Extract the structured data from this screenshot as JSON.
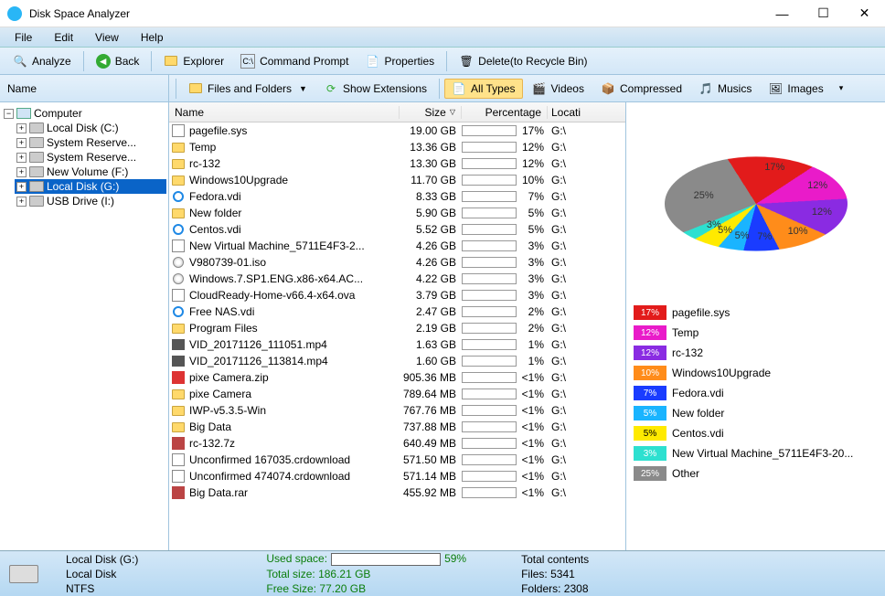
{
  "app": {
    "title": "Disk Space Analyzer"
  },
  "menu": {
    "file": "File",
    "edit": "Edit",
    "view": "View",
    "help": "Help"
  },
  "toolbar": {
    "analyze": "Analyze",
    "back": "Back",
    "explorer": "Explorer",
    "cmd": "Command Prompt",
    "props": "Properties",
    "delete": "Delete(to Recycle Bin)"
  },
  "row2": {
    "name_header": "Name",
    "files_folders": "Files and Folders",
    "show_ext": "Show Extensions",
    "all_types": "All Types",
    "videos": "Videos",
    "compressed": "Compressed",
    "musics": "Musics",
    "images": "Images"
  },
  "tree": {
    "root": "Computer",
    "items": [
      "Local Disk (C:)",
      "System Reserve...",
      "System Reserve...",
      "New Volume (F:)",
      "Local Disk (G:)",
      "USB Drive (I:)"
    ],
    "selected_index": 4
  },
  "cols": {
    "name": "Name",
    "size": "Size",
    "pct": "Percentage",
    "loc": "Locati"
  },
  "files": [
    {
      "icon": "sys",
      "name": "pagefile.sys",
      "size": "19.00 GB",
      "pct": 17,
      "loc": "G:\\"
    },
    {
      "icon": "folder",
      "name": "Temp",
      "size": "13.36 GB",
      "pct": 12,
      "loc": "G:\\"
    },
    {
      "icon": "folder",
      "name": "rc-132",
      "size": "13.30 GB",
      "pct": 12,
      "loc": "G:\\"
    },
    {
      "icon": "folder",
      "name": "Windows10Upgrade",
      "size": "11.70 GB",
      "pct": 10,
      "loc": "G:\\"
    },
    {
      "icon": "ie",
      "name": "Fedora.vdi",
      "size": "8.33 GB",
      "pct": 7,
      "loc": "G:\\"
    },
    {
      "icon": "folder",
      "name": "New folder",
      "size": "5.90 GB",
      "pct": 5,
      "loc": "G:\\"
    },
    {
      "icon": "ie",
      "name": "Centos.vdi",
      "size": "5.52 GB",
      "pct": 5,
      "loc": "G:\\"
    },
    {
      "icon": "sys",
      "name": "New Virtual Machine_5711E4F3-2...",
      "size": "4.26 GB",
      "pct": 3,
      "loc": "G:\\"
    },
    {
      "icon": "iso",
      "name": "V980739-01.iso",
      "size": "4.26 GB",
      "pct": 3,
      "loc": "G:\\"
    },
    {
      "icon": "iso",
      "name": "Windows.7.SP1.ENG.x86-x64.AC...",
      "size": "4.22 GB",
      "pct": 3,
      "loc": "G:\\"
    },
    {
      "icon": "sys",
      "name": "CloudReady-Home-v66.4-x64.ova",
      "size": "3.79 GB",
      "pct": 3,
      "loc": "G:\\"
    },
    {
      "icon": "ie",
      "name": "Free NAS.vdi",
      "size": "2.47 GB",
      "pct": 2,
      "loc": "G:\\"
    },
    {
      "icon": "folder",
      "name": "Program Files",
      "size": "2.19 GB",
      "pct": 2,
      "loc": "G:\\"
    },
    {
      "icon": "vid",
      "name": "VID_20171126_111051.mp4",
      "size": "1.63 GB",
      "pct": 1,
      "loc": "G:\\"
    },
    {
      "icon": "vid",
      "name": "VID_20171126_113814.mp4",
      "size": "1.60 GB",
      "pct": 1,
      "loc": "G:\\"
    },
    {
      "icon": "zip",
      "name": "pixe Camera.zip",
      "size": "905.36 MB",
      "pct": 0.8,
      "loc": "G:\\"
    },
    {
      "icon": "folder",
      "name": "pixe Camera",
      "size": "789.64 MB",
      "pct": 0.7,
      "loc": "G:\\"
    },
    {
      "icon": "folder",
      "name": "IWP-v5.3.5-Win",
      "size": "767.76 MB",
      "pct": 0.6,
      "loc": "G:\\"
    },
    {
      "icon": "folder",
      "name": "Big Data",
      "size": "737.88 MB",
      "pct": 0.6,
      "loc": "G:\\"
    },
    {
      "icon": "zip2",
      "name": "rc-132.7z",
      "size": "640.49 MB",
      "pct": 0.5,
      "loc": "G:\\"
    },
    {
      "icon": "sys",
      "name": "Unconfirmed 167035.crdownload",
      "size": "571.50 MB",
      "pct": 0.5,
      "loc": "G:\\"
    },
    {
      "icon": "sys",
      "name": "Unconfirmed 474074.crdownload",
      "size": "571.14 MB",
      "pct": 0.5,
      "loc": "G:\\"
    },
    {
      "icon": "zip2",
      "name": "Big Data.rar",
      "size": "455.92 MB",
      "pct": 0.4,
      "loc": "G:\\"
    }
  ],
  "chart_data": {
    "type": "pie",
    "title": "",
    "series": [
      {
        "name": "pagefile.sys",
        "value": 17,
        "color": "#e21b1b"
      },
      {
        "name": "Temp",
        "value": 12,
        "color": "#e91bc9"
      },
      {
        "name": "rc-132",
        "value": 12,
        "color": "#8a2be2"
      },
      {
        "name": "Windows10Upgrade",
        "value": 10,
        "color": "#ff8c1a"
      },
      {
        "name": "Fedora.vdi",
        "value": 7,
        "color": "#1a3cff"
      },
      {
        "name": "New folder",
        "value": 5,
        "color": "#1ab4ff"
      },
      {
        "name": "Centos.vdi",
        "value": 5,
        "color": "#ffea00"
      },
      {
        "name": "New Virtual Machine_5711E4F3-20...",
        "value": 3,
        "color": "#2de0d0"
      },
      {
        "name": "Other",
        "value": 25,
        "color": "#8a8a8a"
      }
    ]
  },
  "status": {
    "drive_label": "Local Disk (G:)",
    "drive_type": "Local Disk",
    "fs": "NTFS",
    "used_label": "Used space:",
    "used_pct": 59,
    "total_label": "Total size:",
    "total_val": "186.21 GB",
    "free_label": "Free Size:",
    "free_val": "77.20 GB",
    "contents_label": "Total contents",
    "files_label": "Files:",
    "files_val": "5341",
    "folders_label": "Folders:",
    "folders_val": "2308"
  }
}
